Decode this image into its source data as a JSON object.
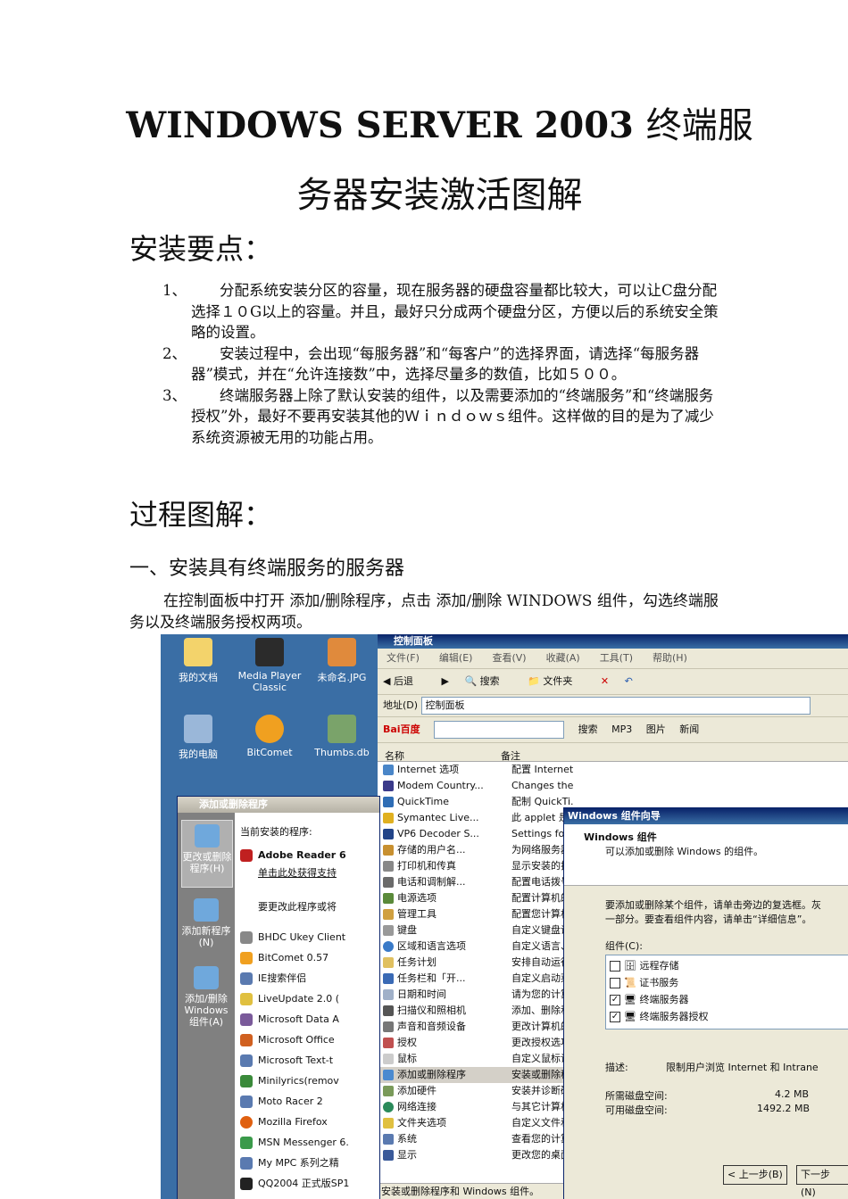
{
  "doc": {
    "title_line1_en": "WINDOWS SERVER 2003",
    "title_line1_zh": "终端服",
    "title_line2": "务器安装激活图解",
    "section1": "安装要点：",
    "items": [
      {
        "num": "1、",
        "text": "分配系统安装分区的容量，现在服务器的硬盘容量都比较大，可以让C盘分配选择１０G以上的容量。并且，最好只分成两个硬盘分区，方便以后的系统安全策略的设置。"
      },
      {
        "num": "2、",
        "text": "安装过程中，会出现“每服务器”和“每客户”的选择界面，请选择“每服务器器”模式，并在“允许连接数”中，选择尽量多的数值，比如５００。"
      },
      {
        "num": "3、",
        "text": "终端服务器上除了默认安装的组件，以及需要添加的“终端服务”和“终端服务授权”外，最好不要再安装其他的Ｗｉｎｄｏｗｓ组件。这样做的目的是为了减少系统资源被无用的功能占用。"
      }
    ],
    "section2": "过程图解：",
    "subsection": "一、安装具有终端服务的服务器",
    "paragraph": "在控制面板中打开 添加/删除程序，点击 添加/删除 WINDOWS 组件，勾选终端服务以及终端服务授权两项。"
  },
  "screenshot": {
    "desktop_icons": [
      {
        "label": "我的文档",
        "color": "#f3d36b"
      },
      {
        "label": "Media Player Classic",
        "color": "#2b2b2b"
      },
      {
        "label": "未命名.JPG",
        "color": "#e08a3c"
      },
      {
        "label": "我的电脑",
        "color": "#9ab7d9"
      },
      {
        "label": "BitComet",
        "color": "#f0a020"
      },
      {
        "label": "Thumbs.db",
        "color": "#7aa36a"
      }
    ],
    "control_panel": {
      "title": "控制面板",
      "menu": [
        "文件(F)",
        "编辑(E)",
        "查看(V)",
        "收藏(A)",
        "工具(T)",
        "帮助(H)"
      ],
      "toolbar": [
        "后退",
        "搜索",
        "文件夹"
      ],
      "address_label": "地址(D)",
      "address_value": "控制面板",
      "baidu_bar": [
        "Bai百度",
        "搜索",
        "MP3",
        "图片",
        "新闻"
      ],
      "col_name": "名称",
      "col_note": "备注",
      "rows": [
        {
          "name": "Internet 选项",
          "note": "配置 Internet ..."
        },
        {
          "name": "Modem Country...",
          "note": "Changes the cou..."
        },
        {
          "name": "QuickTime",
          "note": "配制 QuickTi..."
        },
        {
          "name": "Symantec Live...",
          "note": "此 applet 是"
        },
        {
          "name": "VP6 Decoder S...",
          "note": "Settings fo"
        },
        {
          "name": "存储的用户名...",
          "note": "为网络服务器"
        },
        {
          "name": "打印机和传真",
          "note": "显示安装的打"
        },
        {
          "name": "电话和调制解...",
          "note": "配置电话拨号"
        },
        {
          "name": "电源选项",
          "note": "配置计算机的"
        },
        {
          "name": "管理工具",
          "note": "配置您计算机"
        },
        {
          "name": "键盘",
          "note": "自定义键盘设"
        },
        {
          "name": "区域和语言选项",
          "note": "自定义语言、"
        },
        {
          "name": "任务计划",
          "note": "安排自动运行"
        },
        {
          "name": "任务栏和「开...",
          "note": "自定义启动菜"
        },
        {
          "name": "日期和时间",
          "note": "请为您的计算"
        },
        {
          "name": "扫描仪和照相机",
          "note": "添加、删除和"
        },
        {
          "name": "声音和音频设备",
          "note": "更改计算机的"
        },
        {
          "name": "授权",
          "note": "更改授权选项"
        },
        {
          "name": "鼠标",
          "note": "自定义鼠标设"
        },
        {
          "name": "添加或删除程序",
          "note": "安装或删除程"
        },
        {
          "name": "添加硬件",
          "note": "安装并诊断硬"
        },
        {
          "name": "网络连接",
          "note": "与其它计算机"
        },
        {
          "name": "文件夹选项",
          "note": "自定义文件和"
        },
        {
          "name": "系统",
          "note": "查看您的计算"
        },
        {
          "name": "显示",
          "note": "更改您的桌面"
        }
      ],
      "status": "安装或删除程序和 Windows 组件。"
    },
    "add_remove": {
      "title": "添加或删除程序",
      "side": [
        "更改或删除程序(H)",
        "添加新程序(N)",
        "添加/删除Windows组件(A)"
      ],
      "current_label": "当前安装的程序:",
      "adobe_name": "Adobe Reader 6",
      "adobe_link": "单击此处获得支持",
      "change_text": "要更改此程序或将",
      "programs": [
        "BHDC Ukey Client",
        "BitComet 0.57",
        "IE搜索伴侣",
        "LiveUpdate 2.0 (",
        "Microsoft Data A",
        "Microsoft Office",
        "Microsoft Text-t",
        "Minilyrics(remov",
        "Moto Racer 2",
        "Mozilla Firefox",
        "MSN Messenger 6.",
        "My MPC 系列之精",
        "QQ2004 正式版SP1"
      ]
    },
    "wizard": {
      "title": "Windows 组件向导",
      "heading": "Windows 组件",
      "subheading": "可以添加或删除 Windows 的组件。",
      "instr1": "要添加或删除某个组件，请单击旁边的复选框。灰",
      "instr2": "一部分。要查看组件内容，请单击“详细信息”。",
      "components_label": "组件(C):",
      "components": [
        {
          "name": "远程存储",
          "checked": false
        },
        {
          "name": "证书服务",
          "checked": false
        },
        {
          "name": "终端服务器",
          "checked": true
        },
        {
          "name": "终端服务器授权",
          "checked": true
        }
      ],
      "desc_label": "描述:",
      "desc_value": "限制用户浏览 Internet 和 Intrane",
      "need_label": "所需磁盘空间:",
      "need_value": "4.2 MB",
      "avail_label": "可用磁盘空间:",
      "avail_value": "1492.2 MB",
      "back_button": "< 上一步(B)",
      "next_button": "下一步(N)"
    }
  }
}
